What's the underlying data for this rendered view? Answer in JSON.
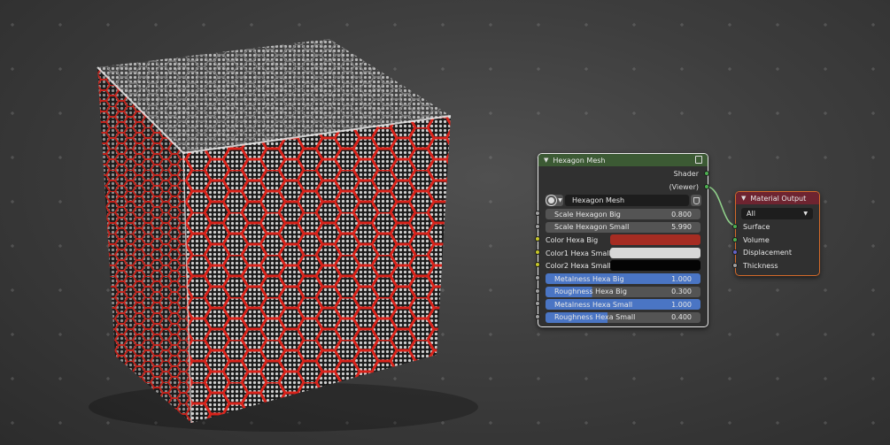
{
  "hexagon_node": {
    "title": "Hexagon Mesh",
    "header_color": "#3c5a34",
    "outputs": [
      {
        "label": "Shader",
        "socket_color": "#4caf50"
      },
      {
        "label": "(Viewer)",
        "socket_color": "#4caf50"
      }
    ],
    "group_name": "Hexagon Mesh",
    "inputs": [
      {
        "label": "Scale Hexagon Big",
        "value": "0.800",
        "kind": "float",
        "socket_color": "#a1a1a1"
      },
      {
        "label": "Scale Hexagon Small",
        "value": "5.990",
        "kind": "float",
        "socket_color": "#a1a1a1"
      },
      {
        "label": "Color Hexa Big",
        "value": "",
        "kind": "color",
        "swatch": "#a52c22",
        "socket_color": "#c7c729"
      },
      {
        "label": "Color1 Hexa Small",
        "value": "",
        "kind": "color",
        "swatch": "#d8d8d8",
        "socket_color": "#c7c729"
      },
      {
        "label": "Color2 Hexa Small",
        "value": "",
        "kind": "color",
        "swatch": "#040404",
        "socket_color": "#c7c729"
      },
      {
        "label": "Metalness Hexa Big",
        "value": "1.000",
        "kind": "slider",
        "fill": 1.0,
        "socket_color": "#a1a1a1"
      },
      {
        "label": "Roughness Hexa Big",
        "value": "0.300",
        "kind": "slider",
        "fill": 0.3,
        "socket_color": "#a1a1a1"
      },
      {
        "label": "Metalness Hexa Small",
        "value": "1.000",
        "kind": "slider",
        "fill": 1.0,
        "socket_color": "#a1a1a1"
      },
      {
        "label": "Roughness Hexa Small",
        "value": "0.400",
        "kind": "slider",
        "fill": 0.4,
        "socket_color": "#a1a1a1"
      }
    ]
  },
  "material_output_node": {
    "title": "Material Output",
    "header_color": "#6e2430",
    "target": "All",
    "inputs": [
      {
        "label": "Surface",
        "socket_color": "#4caf50"
      },
      {
        "label": "Volume",
        "socket_color": "#4caf50"
      },
      {
        "label": "Displacement",
        "socket_color": "#6363c7"
      },
      {
        "label": "Thickness",
        "socket_color": "#a1a1a1"
      }
    ]
  },
  "colors": {
    "hex_outline": "#d8231b",
    "selected_border": "#e8e8e8",
    "active_border": "#d36a2a",
    "link": "#8fcf8a"
  }
}
